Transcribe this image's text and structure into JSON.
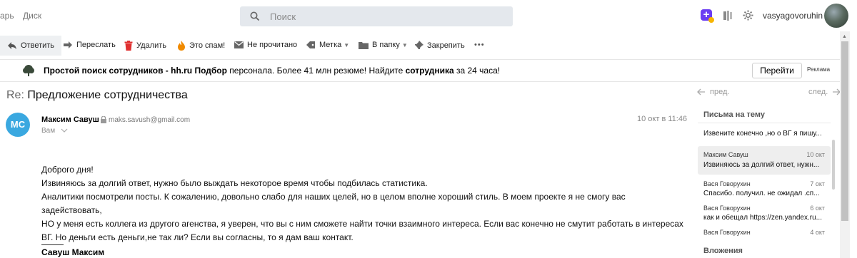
{
  "topnav": {
    "item1": "арь",
    "item2": "Диск"
  },
  "search": {
    "placeholder": "Поиск"
  },
  "user": {
    "name": "vasyagovoruhin"
  },
  "toolbar": {
    "reply": "Ответить",
    "forward": "Переслать",
    "delete": "Удалить",
    "spam": "Это спам!",
    "unread": "Не прочитано",
    "label": "Метка",
    "folder": "В папку",
    "pin": "Закрепить",
    "more": "•••"
  },
  "ad": {
    "bold1": "Простой поиск сотрудников - hh.ru Подбор",
    "text1": " персонала. Более 41 млн резюме! Найдите ",
    "bold2": "сотрудника",
    "text2": " за 24 часа!",
    "button": "Перейти",
    "label": "Реклама"
  },
  "email": {
    "re": "Re:",
    "subject": "Предложение сотрудничества",
    "prev": "пред.",
    "next": "след.",
    "sender_initials": "МС",
    "sender_name": "Максим Савуш",
    "sender_email": "maks.savush@gmail.com",
    "to": "Вам",
    "date": "10 окт в 11:46",
    "body": [
      "Доброго дня!",
      "Извиняюсь за долгий ответ, нужно было выждать некоторое время чтобы подбилась статистика.",
      "Аналитики посмотрели посты. К сожалению, довольно слабо для наших целей, но в целом вполне хороший стиль. В моем проекте я не смогу вас задействовать,",
      "НО у меня есть коллега из другого агенства, я уверен, что вы с ним сможете найти точки взаимного интереса. Если вас конечно не смутит работать в интересах",
      "ВГ. Но деньги есть деньги,не так ли? Если вы согласны, то я дам ваш контакт."
    ],
    "signature": "Савуш Максим"
  },
  "thread": {
    "title": "Письма на тему",
    "items": [
      {
        "sender": "",
        "date": "",
        "snippet": "Извените конечно ,но о ВГ я пишу..."
      },
      {
        "sender": "Максим Савуш",
        "date": "10 окт",
        "snippet": "Извиняюсь за долгий ответ, нужн..."
      },
      {
        "sender": "Вася Говорухин",
        "date": "7 окт",
        "snippet": "Спасибо. получил. не ожидал .сп..."
      },
      {
        "sender": "Вася Говорухин",
        "date": "6 окт",
        "snippet": "как и обещал https://zen.yandex.ru..."
      },
      {
        "sender": "Вася Говорухин",
        "date": "4 окт",
        "snippet": ""
      }
    ]
  },
  "attachments": {
    "title": "Вложения"
  }
}
